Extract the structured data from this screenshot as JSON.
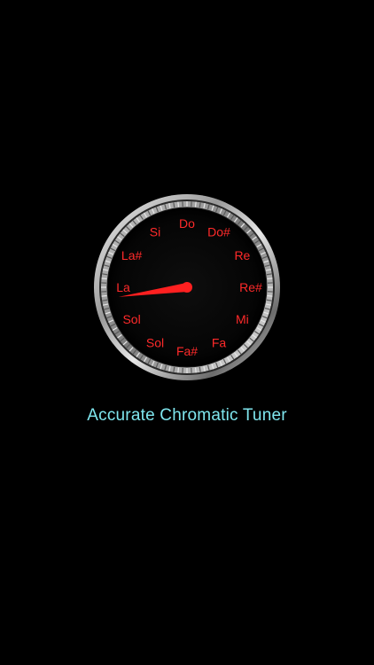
{
  "app": {
    "title": "Accurate Chromatic Tuner"
  },
  "dial": {
    "notes": [
      "Do",
      "Do#",
      "Re",
      "Re#",
      "Mi",
      "Fa",
      "Fa#",
      "Sol",
      "Sol",
      "La",
      "La#",
      "Si"
    ],
    "active_note": "La",
    "needle_color": "#ff2020",
    "label_color": "#ff2a2a"
  }
}
